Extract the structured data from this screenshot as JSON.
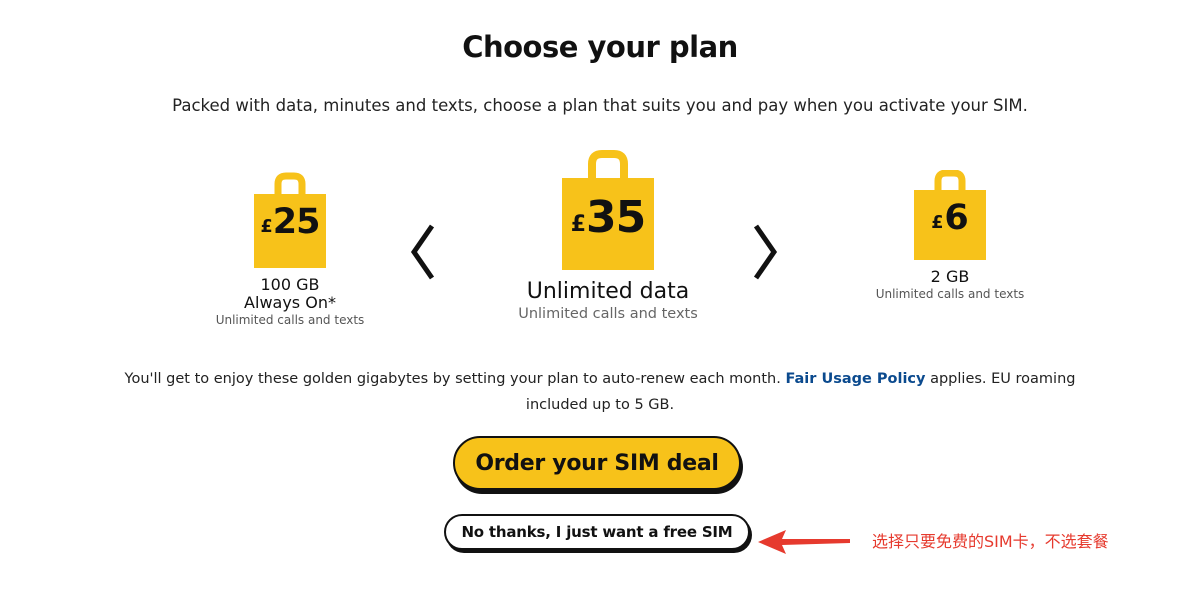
{
  "header": {
    "title": "Choose your plan",
    "subtitle": "Packed with data, minutes and texts, choose a plan that suits you and pay when you activate your SIM."
  },
  "plans": [
    {
      "currency": "£",
      "amount": "25",
      "data": "100 GB",
      "data_extra": "Always On*",
      "details": "Unlimited calls and texts"
    },
    {
      "currency": "£",
      "amount": "35",
      "data": "Unlimited data",
      "details": "Unlimited calls and texts"
    },
    {
      "currency": "£",
      "amount": "6",
      "data": "2 GB",
      "details": "Unlimited calls and texts"
    }
  ],
  "carousel": {
    "prev_icon": "chevron-left-icon",
    "next_icon": "chevron-right-icon"
  },
  "info": {
    "text_before": "You'll get to enjoy these golden gigabytes by setting your plan to auto-renew each month. ",
    "link": "Fair Usage Policy",
    "text_after": " applies. EU roaming included up to 5 GB."
  },
  "actions": {
    "order_label": "Order your SIM deal",
    "free_sim_label": "No thanks, I just want a free SIM"
  },
  "annotation": {
    "text": "选择只要免费的SIM卡，不选套餐",
    "color": "#e63a2e"
  },
  "colors": {
    "brand_yellow": "#f7c21a",
    "link_blue": "#0b4a8e"
  }
}
